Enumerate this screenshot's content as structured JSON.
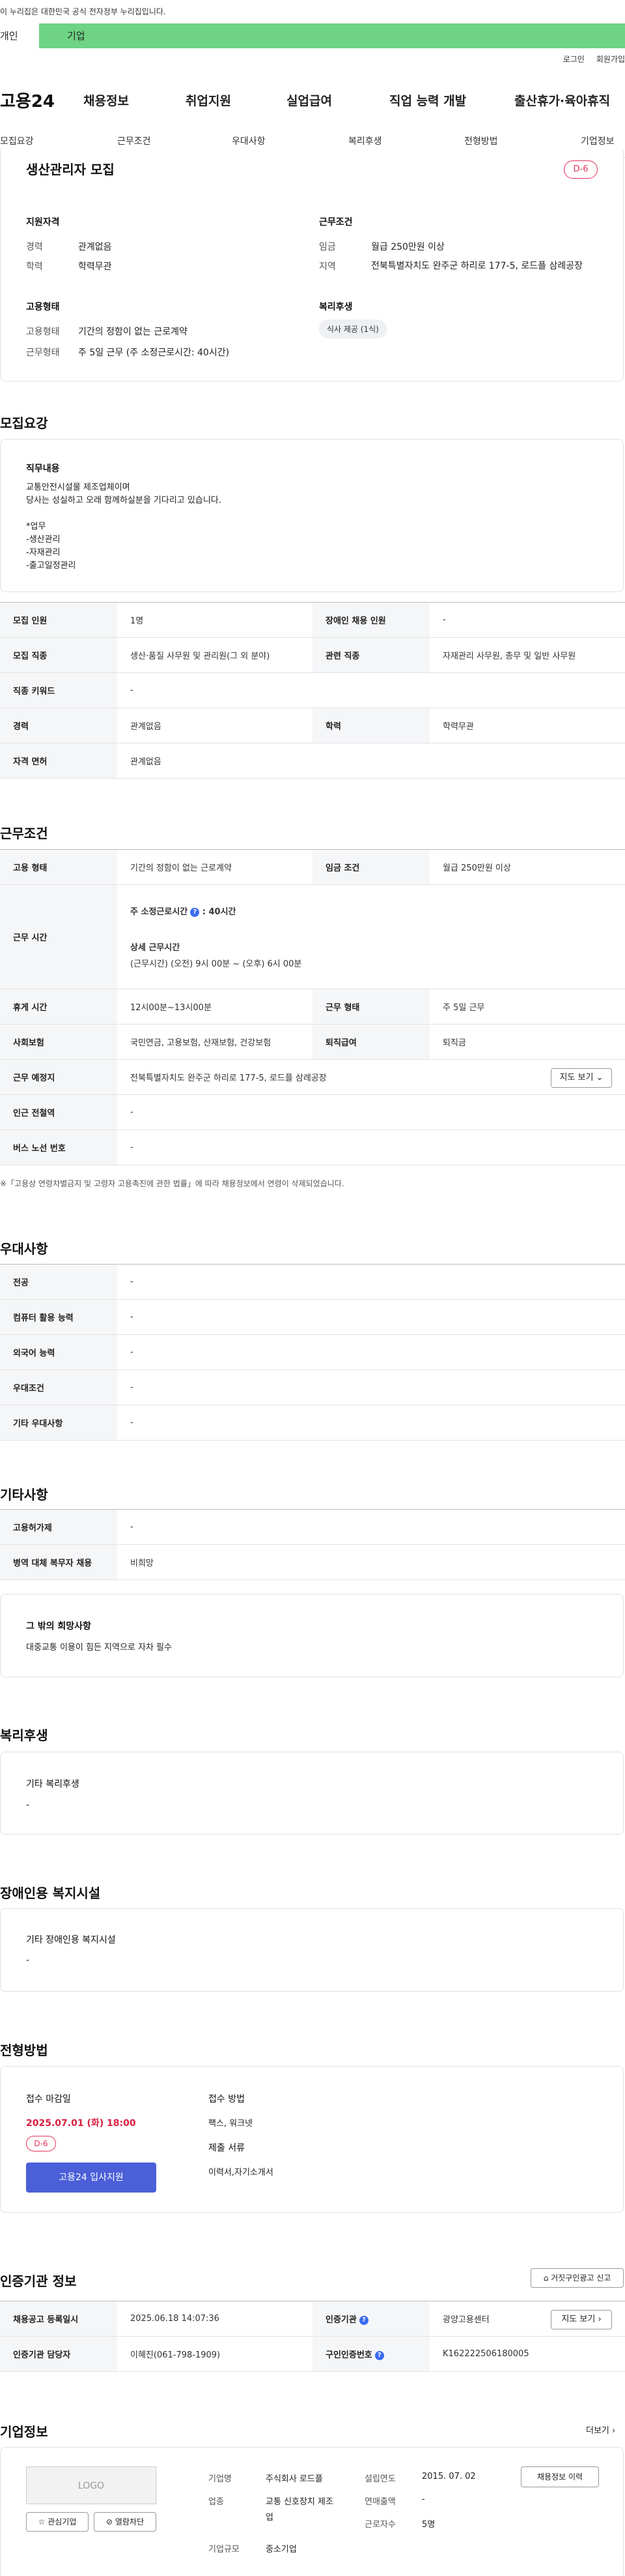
{
  "gov_notice": "이 누리집은 대한민국 공식 전자정부 누리집입니다.",
  "top_tabs": [
    "개인",
    "기업"
  ],
  "util": [
    "로그인",
    "회원가입"
  ],
  "brand": "고용24",
  "gnb": [
    "채용정보",
    "취업지원",
    "실업급여",
    "직업 능력 개발",
    "출산휴가·육아휴직"
  ],
  "subnav": [
    "모집요강",
    "근무조건",
    "우대사항",
    "복리후생",
    "전형방법",
    "기업정보"
  ],
  "job": {
    "title": "생산관리자 모집",
    "dday": "D-6",
    "qual_title": "지원자격",
    "qual": [
      {
        "k": "경력",
        "v": "관계없음"
      },
      {
        "k": "학력",
        "v": "학력무관"
      }
    ],
    "cond_title": "근무조건",
    "cond": [
      {
        "k": "임금",
        "v": "월급 250만원 이상"
      },
      {
        "k": "지역",
        "v": "전북특별자치도 완주군 하리로 177-5, 로드플 삼례공장"
      }
    ],
    "emp_title": "고용형태",
    "emp": [
      {
        "k": "고용형태",
        "v": "기간의 정함이 없는 근로계약"
      },
      {
        "k": "근무형태",
        "v": "주 5일 근무 (주 소정근로시간: 40시간)"
      }
    ],
    "welfare_title": "복리후생",
    "welfare_pill": "식사 제공 (1식)"
  },
  "recruit": {
    "section": "모집요강",
    "duty_title": "직무내용",
    "duty_lines": [
      "교통안전시설물 제조업체이며",
      "당사는 성실하고 오래 함께하실분을 기다리고 있습니다.",
      "",
      "*업무",
      "-생산관리",
      "-자재관리",
      "-출고일정관리"
    ],
    "table": [
      [
        "모집 인원",
        "1명",
        "장애인 채용 인원",
        "-"
      ],
      [
        "모집 직종",
        "생산·품질 사무원 및 관리원(그 외 분야)",
        "관련 직종",
        "자재관리 사무원, 총무 및 일반 사무원"
      ],
      [
        "직종 키워드",
        "-",
        "",
        ""
      ],
      [
        "경력",
        "관계없음",
        "학력",
        "학력무관"
      ],
      [
        "자격 면허",
        "관계없음",
        "",
        ""
      ]
    ]
  },
  "work": {
    "section": "근무조건",
    "r1": [
      "고용 형태",
      "기간의 정함이 없는 근로계약",
      "임금 조건",
      "월급 250만원 이상"
    ],
    "hours_label": "근무 시간",
    "hours_weekly": "주 소정근로시간",
    "hours_weekly_val": ": 40시간",
    "hours_detail_title": "상세 근무시간",
    "hours_detail": "(근무시간) (오전) 9시 00분 ~ (오후) 6시 00분",
    "r3": [
      "휴게 시간",
      "12시00분~13시00분",
      "근무 형태",
      "주 5일 근무"
    ],
    "r4": [
      "사회보험",
      "국민연금, 고용보험, 산재보험, 건강보험",
      "퇴직급여",
      "퇴직금"
    ],
    "place_label": "근무 예정지",
    "place": "전북특별자치도 완주군 하리로 177-5, 로드플 삼례공장",
    "map_btn": "지도 보기 ⌄",
    "r6": [
      "인근 전철역",
      "-"
    ],
    "r7": [
      "버스 노선 번호",
      "-"
    ],
    "note": "※「고용상 연령차별금지 및 고령자 고용촉진에 관한 법률」에 따라 채용정보에서 연령이 삭제되었습니다."
  },
  "pref": {
    "section": "우대사항",
    "rows": [
      [
        "전공",
        "-"
      ],
      [
        "컴퓨터 활용 능력",
        "-"
      ],
      [
        "외국어 능력",
        "-"
      ],
      [
        "우대조건",
        "-"
      ],
      [
        "기타 우대사항",
        "-"
      ]
    ]
  },
  "etc": {
    "section": "기타사항",
    "rows": [
      [
        "고용허가제",
        "-"
      ],
      [
        "병역 대체 복무자 채용",
        "비희망"
      ]
    ],
    "hope_title": "그 밖의 희망사항",
    "hope": "대중교통 이용이 힘든 지역으로 자차 필수"
  },
  "welfare": {
    "section": "복리후생",
    "title": "기타 복리후생",
    "val": "-"
  },
  "disab": {
    "section": "장애인용 복지시설",
    "title": "기타 장애인용 복지시설",
    "val": "-"
  },
  "apply": {
    "section": "전형방법",
    "deadline_title": "접수 마감일",
    "deadline": "2025.07.01 (화) 18:00",
    "dday": "D-6",
    "apply_btn": "고용24 입사지원",
    "method_title": "접수 방법",
    "method": "팩스, 워크넷",
    "docs_title": "제출 서류",
    "docs": "이력서,자기소개서"
  },
  "agency": {
    "section": "인증기관 정보",
    "report_btn": "거짓구인광고 신고",
    "r1": [
      "채용공고 등록일시",
      "2025.06.18 14:07:36",
      "인증기관",
      "광양고용센터"
    ],
    "map_btn": "지도 보기 ›",
    "r2": [
      "인증기관 담당자",
      "이혜진(061-798-1909)",
      "구인인증번호",
      "K162222506180005"
    ]
  },
  "company": {
    "section": "기업정보",
    "more": "더보기 ›",
    "logo": "LOGO",
    "fav": "☆ 관심기업",
    "block": "⊘ 열람차단",
    "info": [
      [
        "기업명",
        "주식회사 로드플"
      ],
      [
        "업종",
        "교통 신호장치 제조업"
      ],
      [
        "기업규모",
        "중소기업"
      ]
    ],
    "info2": [
      [
        "설립연도",
        "2015. 07. 02"
      ],
      [
        "연매출액",
        "-"
      ],
      [
        "근로자수",
        "5명"
      ]
    ],
    "history_btn": "채용정보 이력"
  }
}
